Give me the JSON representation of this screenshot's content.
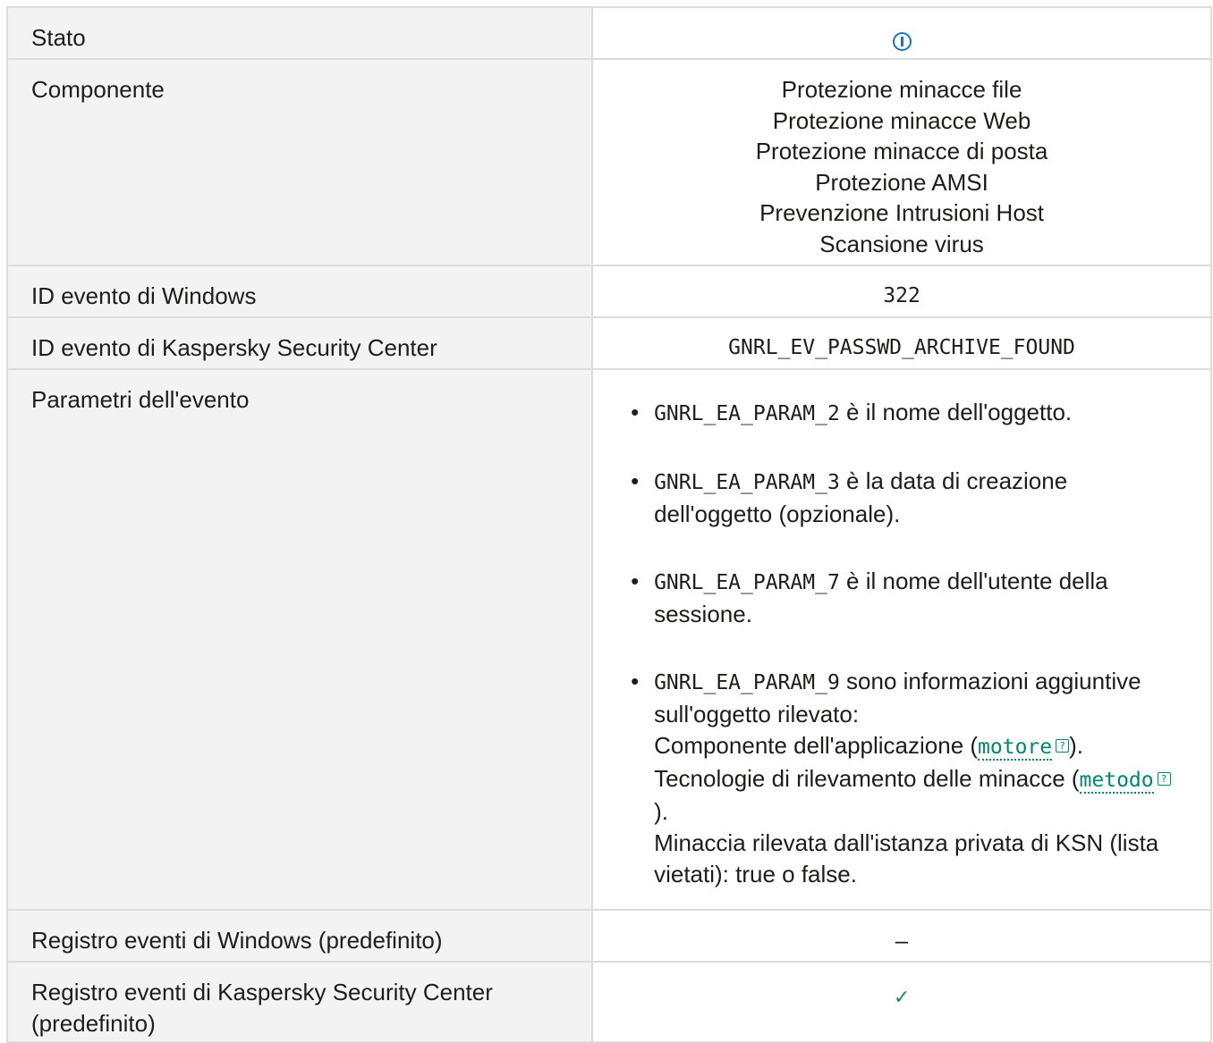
{
  "rows": {
    "stato": {
      "label": "Stato",
      "icon": "info-icon"
    },
    "componente": {
      "label": "Componente",
      "values": [
        "Protezione minacce file",
        "Protezione minacce Web",
        "Protezione minacce di posta",
        "Protezione AMSI",
        "Prevenzione Intrusioni Host",
        "Scansione virus"
      ]
    },
    "windows_id": {
      "label": "ID evento di Windows",
      "value": "322"
    },
    "ksc_id": {
      "label": "ID evento di Kaspersky Security Center",
      "value": "GNRL_EV_PASSWD_ARCHIVE_FOUND"
    },
    "params": {
      "label": "Parametri dell'evento",
      "items": [
        {
          "code": "GNRL_EA_PARAM_2",
          "text": " è il nome dell'oggetto."
        },
        {
          "code": "GNRL_EA_PARAM_3",
          "text": " è la data di creazione dell'oggetto (opzionale)."
        },
        {
          "code": "GNRL_EA_PARAM_7",
          "text": " è il nome dell'utente della sessione."
        },
        {
          "code": "GNRL_EA_PARAM_9",
          "text": " sono informazioni aggiuntive sull'oggetto rilevato:",
          "line1_pre": "Componente dell'applicazione (",
          "line1_link": "motore",
          "line1_post": ").",
          "line2_pre": "Tecnologie di rilevamento delle minacce (",
          "line2_link": "metodo",
          "line2_post": ").",
          "line3": "Minaccia rilevata dall'istanza privata di KSN (lista vietati): true o false."
        }
      ]
    },
    "win_log": {
      "label": "Registro eventi di Windows (predefinito)",
      "value": "–"
    },
    "ksc_log": {
      "label": "Registro eventi di Kaspersky Security Center (predefinito)",
      "icon": "check-icon"
    }
  },
  "colors": {
    "label_bg": "#f3f3f3",
    "border": "#dcdcdc",
    "link": "#00856f",
    "info": "#1a73c9",
    "check": "#1e8c5f"
  }
}
